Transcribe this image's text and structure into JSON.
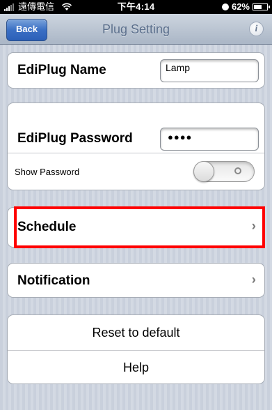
{
  "status_bar": {
    "carrier": "遠傳電信",
    "time": "下午4:14",
    "battery_percent": "62%"
  },
  "nav": {
    "back_label": "Back",
    "title": "Plug Setting",
    "info_glyph": "i"
  },
  "name_section": {
    "label": "EdiPlug Name",
    "value": "Lamp"
  },
  "password_section": {
    "label": "EdiPlug Password",
    "value": "●●●●",
    "show_password_label": "Show Password",
    "show_password_on": false
  },
  "schedule": {
    "label": "Schedule",
    "chevron": "›"
  },
  "notification": {
    "label": "Notification",
    "chevron": "›"
  },
  "actions": {
    "reset_label": "Reset to default",
    "help_label": "Help"
  },
  "colors": {
    "highlight": "#ff0000",
    "back_button": "#3a6fc4",
    "nav_title": "#5b6f8c"
  }
}
